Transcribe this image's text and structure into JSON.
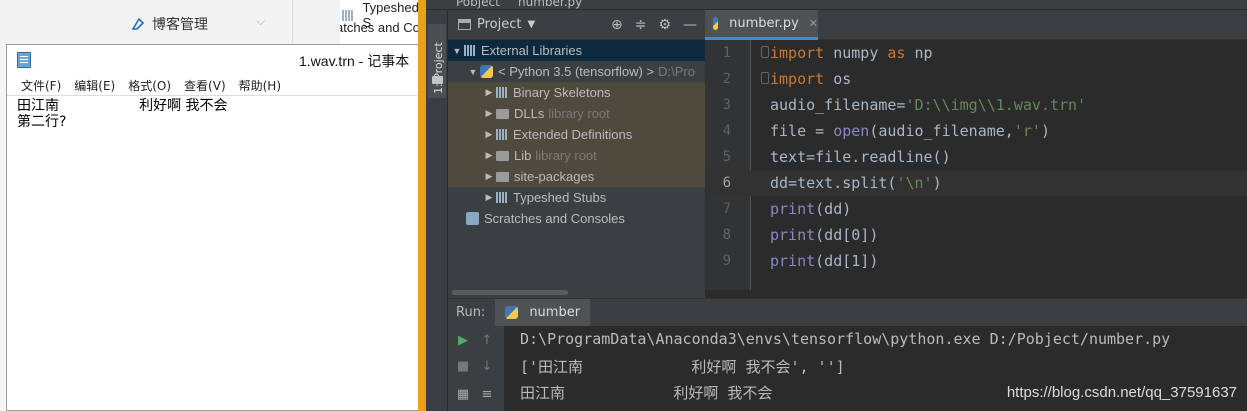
{
  "background": {
    "blog_menu_label": "博客管理",
    "ghost_lines": [
      "Typeshed S",
      "atches and Co"
    ]
  },
  "notepad": {
    "title": "1.wav.trn - 记事本",
    "menu": [
      "文件(F)",
      "编辑(E)",
      "格式(O)",
      "查看(V)",
      "帮助(H)"
    ],
    "content_line1": "田江南                  利好啊 我不会",
    "content_line2": "第二行?"
  },
  "ide": {
    "top_strip": [
      "Pobject",
      "number.py"
    ],
    "side_tab_label": "1: Project",
    "project_dropdown": "Project",
    "tree": [
      {
        "label": "External Libraries",
        "extra": "",
        "level": 0,
        "icon": "lib",
        "expanded": true
      },
      {
        "label": "< Python 3.5 (tensorflow) >",
        "extra": "D:\\Pro",
        "level": 1,
        "icon": "python",
        "expanded": true
      },
      {
        "label": "Binary Skeletons",
        "extra": "",
        "level": 2,
        "icon": "lib",
        "expanded": false
      },
      {
        "label": "DLLs",
        "extra": "library root",
        "level": 2,
        "icon": "folder",
        "expanded": false
      },
      {
        "label": "Extended Definitions",
        "extra": "",
        "level": 2,
        "icon": "lib",
        "expanded": false
      },
      {
        "label": "Lib",
        "extra": "library root",
        "level": 2,
        "icon": "folder",
        "expanded": false
      },
      {
        "label": "site-packages",
        "extra": "",
        "level": 2,
        "icon": "folder",
        "expanded": false
      },
      {
        "label": "Typeshed Stubs",
        "extra": "",
        "level": 2,
        "icon": "lib",
        "expanded": false
      },
      {
        "label": "Scratches and Consoles",
        "extra": "",
        "level": 0,
        "icon": "scratch",
        "expanded": null
      }
    ],
    "editor_tab": "number.py",
    "line_numbers": [
      "1",
      "2",
      "3",
      "4",
      "5",
      "6",
      "7",
      "8",
      "9"
    ],
    "code_lines": [
      "import numpy as np",
      "import os",
      "audio_filename='D:\\\\img\\\\1.wav.trn'",
      "file = open(audio_filename,'r')",
      "text=file.readline()",
      "dd=text.split('\\n')",
      "print(dd)",
      "print(dd[0])",
      "print(dd[1])"
    ],
    "current_line": 6,
    "run": {
      "label": "Run:",
      "tab": "number",
      "output": [
        "D:\\ProgramData\\Anaconda3\\envs\\tensorflow\\python.exe D:/Pobject/number.py",
        "['田江南            利好啊 我不会', '']",
        "田江南            利好啊 我不会"
      ]
    },
    "colors": {
      "keyword": "#cc7832",
      "string": "#6a8759",
      "builtin": "#8888c6",
      "text": "#a9b7c6",
      "run_green": "#59a869"
    }
  },
  "watermark": "https://blog.csdn.net/qq_37591637"
}
